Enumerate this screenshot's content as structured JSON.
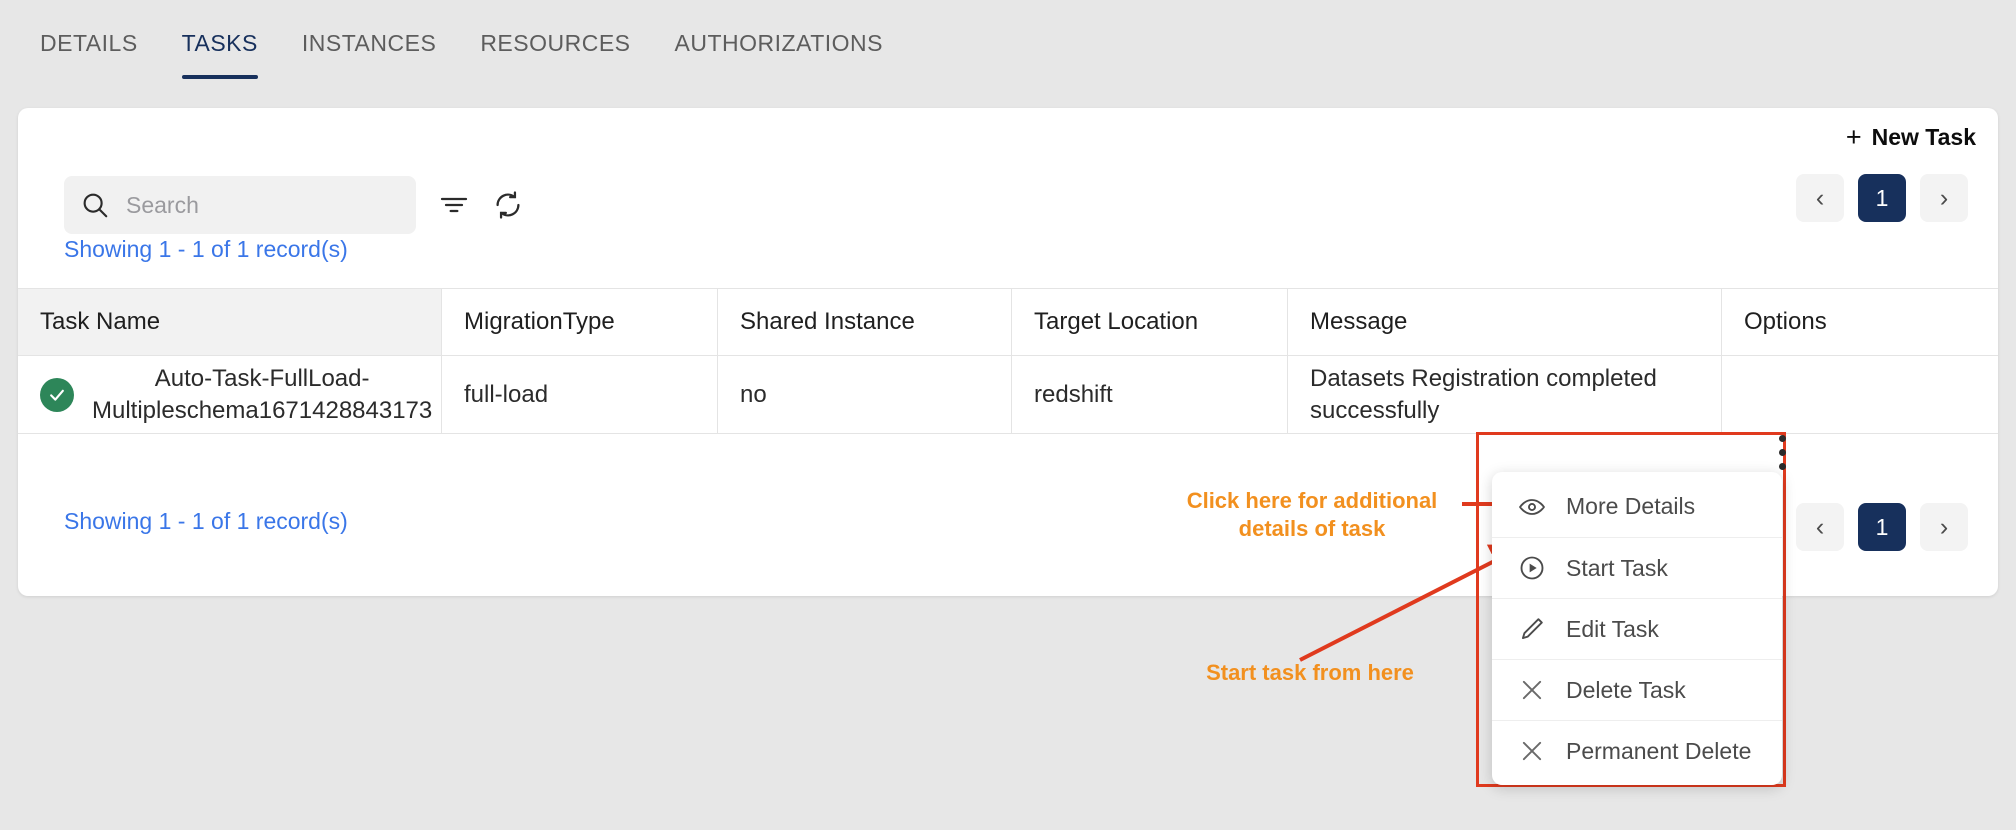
{
  "tabs": [
    {
      "label": "DETAILS",
      "active": false
    },
    {
      "label": "TASKS",
      "active": true
    },
    {
      "label": "INSTANCES",
      "active": false
    },
    {
      "label": "RESOURCES",
      "active": false
    },
    {
      "label": "AUTHORIZATIONS",
      "active": false
    }
  ],
  "toolbar": {
    "new_task_label": "New Task",
    "new_task_plus": "+",
    "search_placeholder": "Search",
    "search_value": "",
    "filter_icon": "filter-icon",
    "refresh_icon": "refresh-icon"
  },
  "pagination": {
    "prev_label": "‹",
    "next_label": "›",
    "current_page": "1"
  },
  "records_summary": "Showing 1 - 1 of 1 record(s)",
  "table": {
    "headers": [
      "Task Name",
      "MigrationType",
      "Shared Instance",
      "Target Location",
      "Message",
      "Options"
    ],
    "rows": [
      {
        "status": "success",
        "task_name": "Auto-Task-FullLoad-Multipleschema1671428843173",
        "migration_type": "full-load",
        "shared_instance": "no",
        "target_location": "redshift",
        "message": "Datasets Registration completed successfully",
        "options_icon": "kebab-menu-icon"
      }
    ]
  },
  "context_menu": {
    "items": [
      {
        "label": "More Details",
        "icon": "eye-icon"
      },
      {
        "label": "Start Task",
        "icon": "play-circle-icon"
      },
      {
        "label": "Edit Task",
        "icon": "pencil-icon"
      },
      {
        "label": "Delete Task",
        "icon": "close-x-icon"
      },
      {
        "label": "Permanent Delete",
        "icon": "close-x-icon"
      }
    ]
  },
  "annotations": [
    {
      "text": "Click here for additional details of task"
    },
    {
      "text": "Start task from here"
    }
  ],
  "colors": {
    "accent_navy": "#17305c",
    "link_blue": "#3a76e8",
    "status_green": "#2d8659",
    "annotation_orange": "#f2901f",
    "highlight_red": "#e03a1e",
    "page_bg": "#e7e7e7"
  }
}
